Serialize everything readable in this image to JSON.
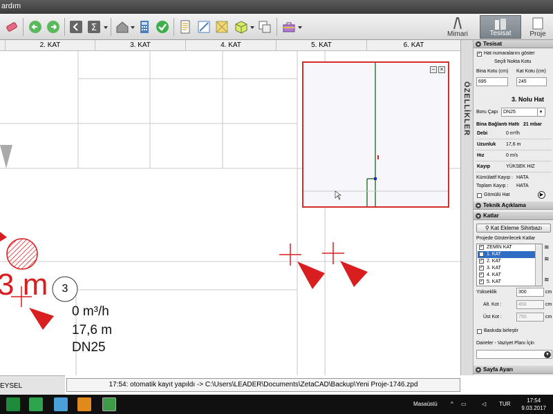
{
  "titlebar": {
    "title": "ardım"
  },
  "toolbar": {
    "modes": [
      {
        "label": "Mimari",
        "active": false
      },
      {
        "label": "Tesisat",
        "active": true
      },
      {
        "label": "Proje",
        "active": false
      }
    ]
  },
  "floors": {
    "labels": [
      "2. KAT",
      "3. KAT",
      "4. KAT",
      "5. KAT",
      "6. KAT"
    ]
  },
  "canvas": {
    "big_label": "3 m",
    "line_number": "3",
    "info": [
      "0 m³/h",
      "17,6 m",
      "DN25"
    ]
  },
  "status": {
    "left": "EYSEL",
    "message": "17:54: otomatik kayıt yapıldı -> C:\\Users\\LEADER\\Documents\\ZetaCAD\\Backup\\Yeni Proje-1746.zpd"
  },
  "sidebar_tab": "ÖZELLİKLER",
  "panel": {
    "tesisat": {
      "header": "Tesisat",
      "show_numbers_label": "Hat numaralarını göster",
      "point_level_label": "Seçili Nokta Kotu",
      "bina_kotu_label": "Bina Kotu (cm)",
      "kat_kotu_label": "Kat Kotu (cm)",
      "bina_kotu": "695",
      "kat_kotu": "245",
      "line_title": "3. Nolu Hat",
      "pipe_label": "Boru Çapı",
      "pipe_value": "DN25",
      "conn_label": "Bina Bağlantı Hattı",
      "conn_value": "21 mbar",
      "props": [
        {
          "key": "Debi",
          "value": "0 m³/h"
        },
        {
          "key": "Uzunluk",
          "value": "17,6 m"
        },
        {
          "key": "Hız",
          "value": "0 m/s"
        },
        {
          "key": "Kayıp",
          "value": "YÜKSEK HIZ"
        }
      ],
      "kumulatif_label": "Kümülatif Kayıp :",
      "kumulatif_value": "HATA",
      "toplam_label": "Toplam Kayıp :",
      "toplam_value": "HATA",
      "gomulu_label": "Gömülü Hat"
    },
    "teknik": {
      "header": "Teknik Açıklama"
    },
    "katlar": {
      "header": "Katlar",
      "wizard_button": "Kat Ekleme Sihirbazı",
      "list_label": "Projede Gösterilecek Katlar",
      "items": [
        "ZEMİN KAT",
        "1. KAT",
        "2. KAT",
        "3. KAT",
        "4. KAT",
        "5. KAT"
      ],
      "yukseklik_label": "Yükseklik",
      "yukseklik": "300",
      "alt_kot_label": "Alt. Kot :",
      "alt_kot": "450",
      "ust_kot_label": "Üst Kot :",
      "ust_kot": "750",
      "unit": "cm",
      "baskida_label": "Baskıda birleştir",
      "daireler_label": "Daireler - Vaziyet Planı İçin"
    },
    "sayfa": {
      "header": "Sayfa Ayarı"
    }
  },
  "taskbar": {
    "desktop_label": "Masaüstü",
    "lang": "TUR",
    "time": "17:54",
    "date": "9.03.2017"
  }
}
